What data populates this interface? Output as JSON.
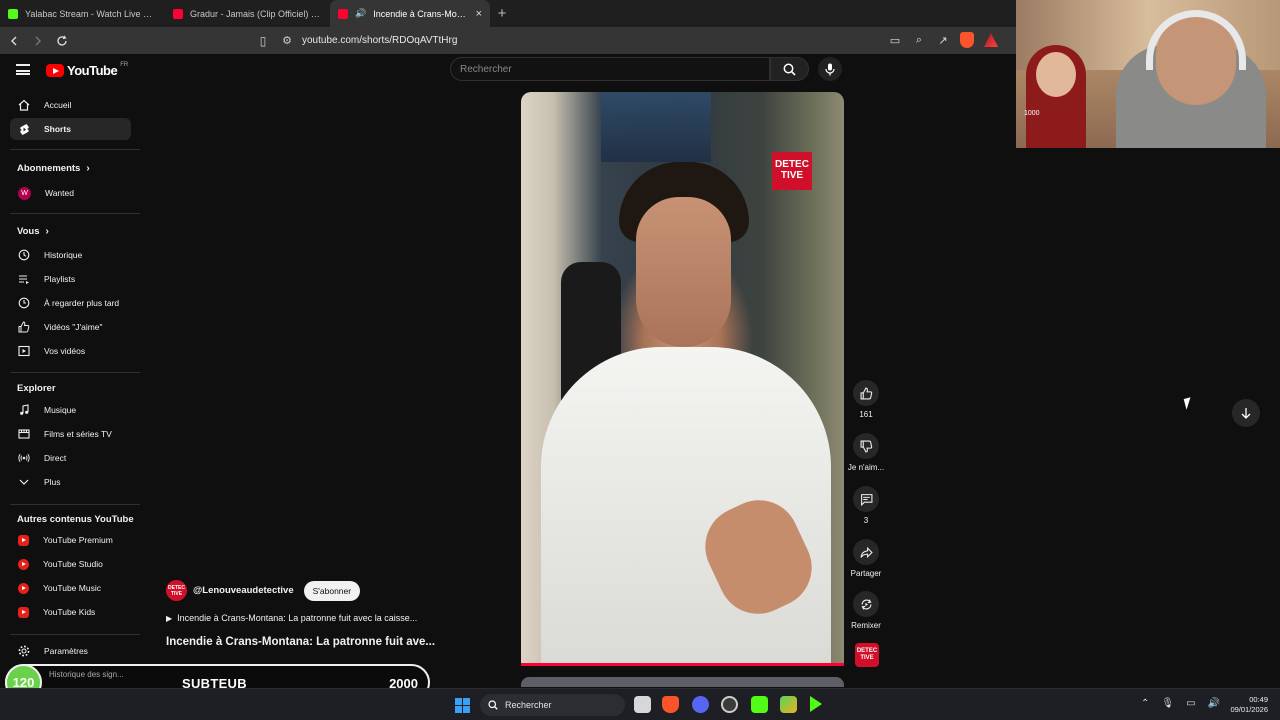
{
  "browser": {
    "tabs": [
      {
        "title": "Yalabac Stream - Watch Live on Kick",
        "favicon_color": "#53fc18",
        "active": false
      },
      {
        "title": "Gradur - Jamais (Clip Officiel) - YouTube",
        "favicon_color": "#ff0033",
        "active": false
      },
      {
        "title": "Incendie à Crans-Montana: La patronne",
        "favicon_color": "#ff0033",
        "active": true
      }
    ],
    "url": "youtube.com/shorts/RDOqAVTtHrg"
  },
  "youtube": {
    "logo_text": "YouTube",
    "logo_country": "FR",
    "search_placeholder": "Rechercher",
    "sidebar": {
      "main": [
        {
          "label": "Accueil",
          "icon": "home-icon"
        },
        {
          "label": "Shorts",
          "icon": "shorts-icon",
          "active": true
        }
      ],
      "subscriptions_title": "Abonnements",
      "subscriptions": [
        {
          "label": "Wanted",
          "avatar_letter": "W"
        }
      ],
      "you_title": "Vous",
      "you": [
        {
          "label": "Historique",
          "icon": "history-icon"
        },
        {
          "label": "Playlists",
          "icon": "playlist-icon"
        },
        {
          "label": "À regarder plus tard",
          "icon": "clock-icon"
        },
        {
          "label": "Vidéos \"J'aime\"",
          "icon": "thumb-up-icon"
        },
        {
          "label": "Vos vidéos",
          "icon": "video-icon"
        }
      ],
      "explore_title": "Explorer",
      "explore": [
        {
          "label": "Musique",
          "icon": "music-icon"
        },
        {
          "label": "Films et séries TV",
          "icon": "film-icon"
        },
        {
          "label": "Direct",
          "icon": "live-icon"
        },
        {
          "label": "Plus",
          "icon": "chevron-down-icon"
        }
      ],
      "more_title": "Autres contenus YouTube",
      "more": [
        {
          "label": "YouTube Premium"
        },
        {
          "label": "YouTube Studio"
        },
        {
          "label": "YouTube Music"
        },
        {
          "label": "YouTube Kids"
        }
      ],
      "settings_label": "Paramètres",
      "report_label": "Historique des sign..."
    },
    "short": {
      "channel_handle": "@Lenouveaudetective",
      "channel_badge": "DETEC TIVE",
      "subscribe_label": "S'abonner",
      "playlist_line": "Incendie à Crans-Montana: La patronne fuit avec la caisse...",
      "title": "Incendie à Crans-Montana: La patronne fuit ave...",
      "video_logo": "DETEC TIVE",
      "likes": "161",
      "dislike_label": "Je n'aim...",
      "comments": "3",
      "share_label": "Partager",
      "remix_label": "Remixer"
    }
  },
  "overlay": {
    "badge": "120",
    "name": "SUBTEUB",
    "goal": "2000",
    "webcam_tag": "1000"
  },
  "taskbar": {
    "search_label": "Rechercher",
    "time": "00:49",
    "date": "09/01/2026"
  }
}
